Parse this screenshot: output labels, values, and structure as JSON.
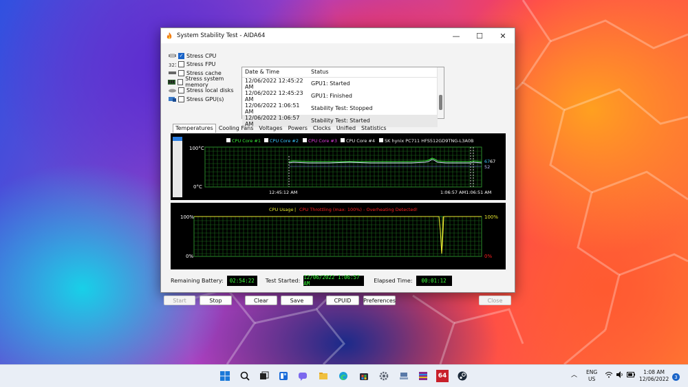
{
  "window": {
    "title": "System Stability Test - AIDA64",
    "minimize_glyph": "—",
    "maximize_glyph": "☐",
    "close_glyph": "✕"
  },
  "stress_options": [
    {
      "label": "Stress CPU",
      "checked": true,
      "icon": "cpu-icon"
    },
    {
      "label": "Stress FPU",
      "checked": false,
      "icon": "fpu-icon"
    },
    {
      "label": "Stress cache",
      "checked": false,
      "icon": "cache-icon"
    },
    {
      "label": "Stress system memory",
      "checked": false,
      "icon": "memory-icon"
    },
    {
      "label": "Stress local disks",
      "checked": false,
      "icon": "disk-icon"
    },
    {
      "label": "Stress GPU(s)",
      "checked": false,
      "icon": "gpu-icon"
    }
  ],
  "log": {
    "headers": [
      "Date & Time",
      "Status"
    ],
    "rows": [
      [
        "12/06/2022 12:45:22 AM",
        "GPU1: Started"
      ],
      [
        "12/06/2022 12:45:23 AM",
        "GPU1: Finished"
      ],
      [
        "12/06/2022 1:06:51 AM",
        "Stability Test: Stopped"
      ],
      [
        "12/06/2022 1:06:57 AM",
        "Stability Test: Started"
      ]
    ]
  },
  "tabs": [
    "Temperatures",
    "Cooling Fans",
    "Voltages",
    "Powers",
    "Clocks",
    "Unified",
    "Statistics"
  ],
  "temp_graph": {
    "legend": [
      {
        "label": "CPU Core #1",
        "color": "#39e839"
      },
      {
        "label": "CPU Core #2",
        "color": "#3cc8ff"
      },
      {
        "label": "CPU Core #3",
        "color": "#e040e0"
      },
      {
        "label": "CPU Core #4",
        "color": "#f0f0f0"
      },
      {
        "label": "SK hynix PC711 HFS512GD9TNG-L3A0B",
        "color": "#f0f0f0"
      }
    ],
    "y_top": "100°C",
    "y_bottom": "0°C",
    "x_left": "12:45:12 AM",
    "x_right": "1:06:57 AM1:06:51 AM",
    "val_a": "67",
    "val_b": "67",
    "val_c": "52"
  },
  "cpu_graph": {
    "title_usage": "CPU Usage",
    "title_sep": "|",
    "title_throttle": "CPU Throttling (max: 100%) - Overheating Detected!",
    "usage_color": "#e8e830",
    "throttle_color": "#ff2020",
    "y_top_left": "100%",
    "y_bottom_left": "0%",
    "y_top_right": "100%",
    "y_bottom_right": "0%"
  },
  "status": {
    "remaining_battery_label": "Remaining Battery:",
    "remaining_battery": "02:54:22",
    "test_started_label": "Test Started:",
    "test_started": "12/06/2022 1:06:57 AM",
    "elapsed_label": "Elapsed Time:",
    "elapsed": "00:01:12"
  },
  "buttons": {
    "start": "Start",
    "stop": "Stop",
    "clear": "Clear",
    "save": "Save",
    "cpuid": "CPUID",
    "preferences": "Preferences",
    "close": "Close"
  },
  "taskbar": {
    "lang_top": "ENG",
    "lang_bottom": "US",
    "time": "1:08 AM",
    "date": "12/06/2022",
    "notifications": "3",
    "aida_label": "64",
    "icons": [
      "windows-start-icon",
      "search-icon",
      "task-view-icon",
      "widgets-icon",
      "teams-chat-icon",
      "file-explorer-icon",
      "edge-icon",
      "store-icon",
      "settings-icon",
      "network-tool-icon",
      "winrar-icon",
      "aida64-icon",
      "steam-icon"
    ]
  }
}
